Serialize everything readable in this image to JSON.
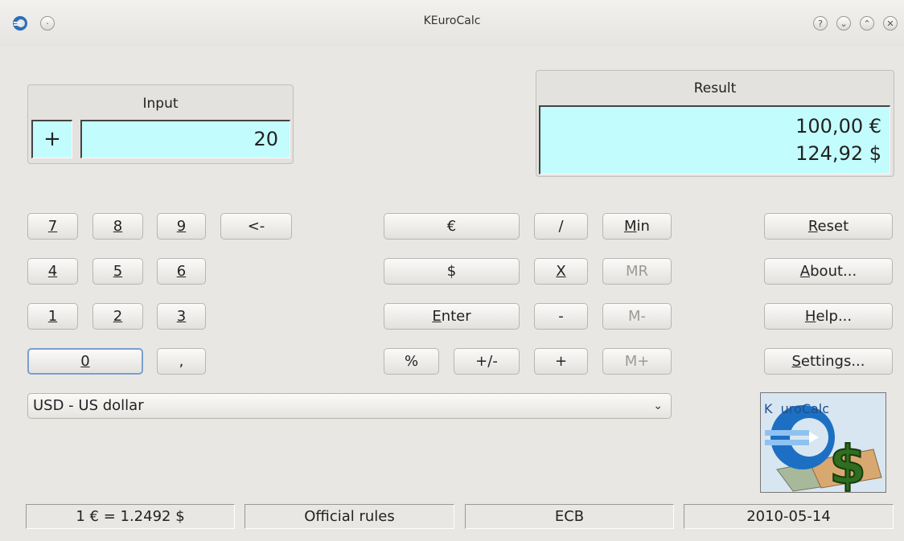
{
  "window": {
    "title": "KEuroCalc",
    "buttons": [
      "?",
      "⌄",
      "⌃",
      "✕"
    ]
  },
  "input": {
    "title": "Input",
    "sign": "+",
    "value": "20"
  },
  "result": {
    "title": "Result",
    "line1": "100,00 €",
    "line2": "124,92 $"
  },
  "keypad": {
    "k7": "7",
    "k8": "8",
    "k9": "9",
    "back": "<-",
    "k4": "4",
    "k5": "5",
    "k6": "6",
    "k1": "1",
    "k2": "2",
    "k3": "3",
    "k0": "0",
    "comma": ","
  },
  "ops": {
    "euro": "€",
    "dollar": "$",
    "enter": "Enter",
    "percent": "%",
    "plusminus": "+/-",
    "divide": "/",
    "multiply": "X",
    "minus": "-",
    "plus": "+",
    "min": "Min",
    "mr": "MR",
    "mminus": "M-",
    "mplus": "M+"
  },
  "side": {
    "reset": "Reset",
    "about": "About...",
    "help": "Help...",
    "settings": "Settings..."
  },
  "currency": {
    "selected": "USD - US dollar"
  },
  "logo": {
    "text": "K  uroCalc"
  },
  "statusbar": {
    "rate": "1 € = 1.2492 $",
    "rules": "Official rules",
    "source": "ECB",
    "date": "2010-05-14"
  },
  "colors": {
    "display_bg": "#c3fcfd",
    "window_bg": "#e9e7e3",
    "focus": "#7a9fd0"
  }
}
